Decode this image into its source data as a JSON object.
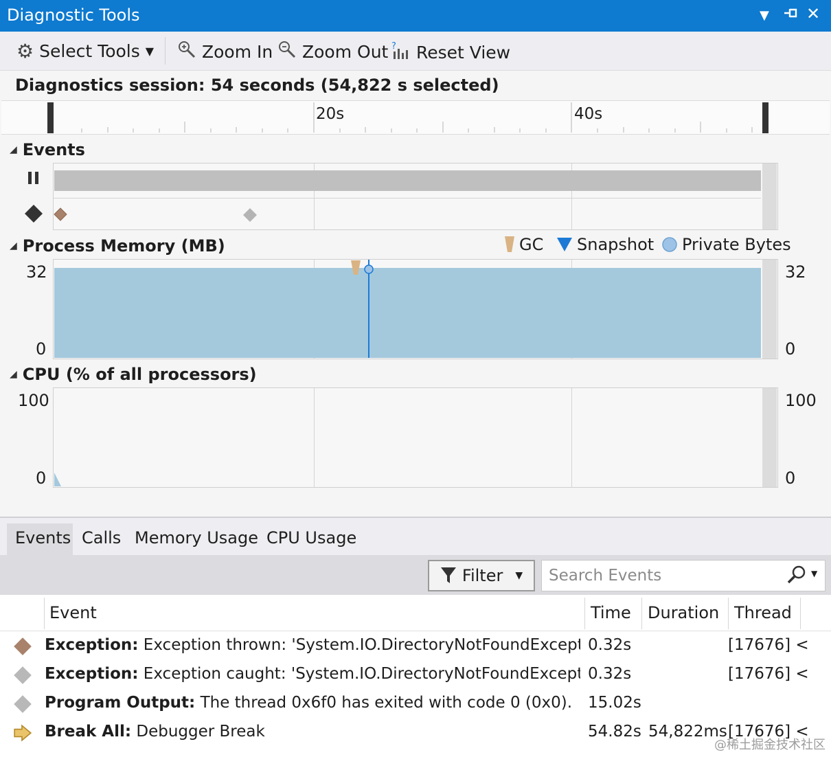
{
  "window": {
    "title": "Diagnostic Tools"
  },
  "toolbar": {
    "select_tools": "Select Tools",
    "zoom_in": "Zoom In",
    "zoom_out": "Zoom Out",
    "reset_view": "Reset View"
  },
  "session": {
    "text": "Diagnostics session: 54 seconds (54,822 s selected)"
  },
  "ruler": {
    "ticks": [
      "20s",
      "40s"
    ]
  },
  "events_section": {
    "title": "Events"
  },
  "memory_section": {
    "title": "Process Memory (MB)",
    "legend": [
      "GC",
      "Snapshot",
      "Private Bytes"
    ],
    "y_max": "32",
    "y_min": "0",
    "y_max_right": "32",
    "y_min_right": "0"
  },
  "cpu_section": {
    "title": "CPU (% of all processors)",
    "y_max": "100",
    "y_min": "0",
    "y_max_right": "100",
    "y_min_right": "0"
  },
  "colors": {
    "accent": "#0e7ad0",
    "memory_fill": "#a4c9dd",
    "exception": "#a9826b",
    "gc": "#d9b383",
    "snapshot": "#1c7ad5"
  },
  "tabs": [
    "Events",
    "Calls",
    "Memory Usage",
    "CPU Usage"
  ],
  "filter": {
    "label": "Filter",
    "search_placeholder": "Search Events"
  },
  "table": {
    "headers": {
      "event": "Event",
      "time": "Time",
      "duration": "Duration",
      "thread": "Thread"
    },
    "rows": [
      {
        "icon": "exception-thrown-icon",
        "kind": "Exception:",
        "text": " Exception thrown: 'System.IO.DirectoryNotFoundExceptio...",
        "time": "0.32s",
        "duration": "",
        "thread": "[17676] <"
      },
      {
        "icon": "exception-caught-icon",
        "kind": "Exception:",
        "text": " Exception caught: 'System.IO.DirectoryNotFoundExceptio...",
        "time": "0.32s",
        "duration": "",
        "thread": "[17676] <"
      },
      {
        "icon": "program-output-icon",
        "kind": "Program Output:",
        "text": " The thread 0x6f0 has exited with code 0 (0x0).",
        "time": "15.02s",
        "duration": "",
        "thread": ""
      },
      {
        "icon": "break-arrow-icon",
        "kind": "Break All:",
        "text": " Debugger Break",
        "time": "54.82s",
        "duration": "54,822ms",
        "thread": "[17676] <"
      }
    ]
  },
  "watermark": "@稀土掘金技术社区"
}
